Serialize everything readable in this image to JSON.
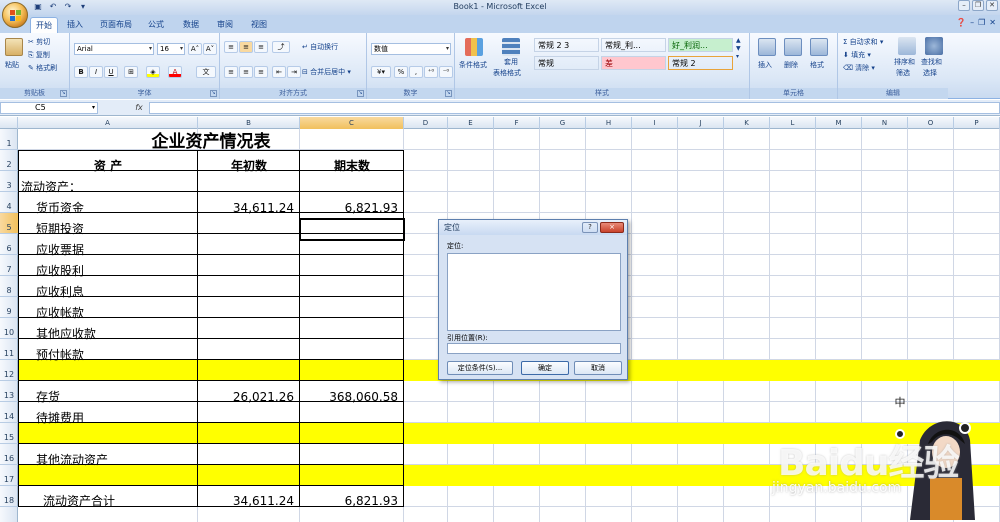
{
  "window": {
    "title": "Book1 - Microsoft Excel"
  },
  "tabs": [
    {
      "label": "开始",
      "active": true
    },
    {
      "label": "插入"
    },
    {
      "label": "页面布局"
    },
    {
      "label": "公式"
    },
    {
      "label": "数据"
    },
    {
      "label": "审阅"
    },
    {
      "label": "视图"
    }
  ],
  "ribbon": {
    "clipboard": {
      "label": "剪贴板",
      "paste": "粘贴",
      "cut": "剪切",
      "copy": "复制",
      "format_painter": "格式刷"
    },
    "font": {
      "label": "字体",
      "font_name": "Arial",
      "font_size": "16",
      "bold": "B",
      "italic": "I",
      "underline": "U"
    },
    "alignment": {
      "label": "对齐方式",
      "wrap": "自动换行",
      "merge": "合并后居中"
    },
    "number": {
      "label": "数字",
      "format": "数值",
      "percent": "%"
    },
    "styles": {
      "label": "样式",
      "conditional": "条件格式",
      "table": "套用",
      "table2": "表格格式",
      "cells": [
        {
          "text": "常规 2 3",
          "bg": "#ffffff"
        },
        {
          "text": "常规_利...",
          "bg": "#ffffff"
        },
        {
          "text": "好_利润...",
          "bg": "#c6efce",
          "color": "#006100"
        },
        {
          "text": "常规",
          "bg": "#ffffff"
        },
        {
          "text": "差",
          "bg": "#ffc7ce",
          "color": "#9c0006"
        },
        {
          "text": "常规 2",
          "bg": "#ffffff"
        }
      ]
    },
    "cells_group": {
      "label": "单元格",
      "insert": "插入",
      "delete": "删除",
      "format": "格式"
    },
    "editing": {
      "label": "编辑",
      "autosum": "自动求和",
      "fill": "填充",
      "clear": "清除",
      "sort": "排序和",
      "sort2": "筛选",
      "find": "查找和",
      "find2": "选择"
    }
  },
  "formula_bar": {
    "name_box": "C5",
    "fx": "fx"
  },
  "columns": [
    "A",
    "B",
    "C",
    "D",
    "E",
    "F",
    "G",
    "H",
    "I",
    "J",
    "K",
    "L",
    "M",
    "N",
    "O",
    "P"
  ],
  "rows": [
    "1",
    "2",
    "3",
    "4",
    "5",
    "6",
    "7",
    "8",
    "9",
    "10",
    "11",
    "12",
    "13",
    "14",
    "15",
    "16",
    "17",
    "18"
  ],
  "sheet": {
    "title": "企业资产情况表",
    "header": {
      "a": "资        产",
      "b": "年初数",
      "c": "期末数"
    },
    "section": "流动资产：",
    "r4": {
      "a": "货币资金",
      "b": "34,611.24",
      "c": "6,821.93"
    },
    "r5": {
      "a": "短期投资"
    },
    "r6": {
      "a": "应收票据"
    },
    "r7": {
      "a": "应收股利"
    },
    "r8": {
      "a": "应收利息"
    },
    "r9": {
      "a": "应收帐款"
    },
    "r10": {
      "a": "其他应收款"
    },
    "r11": {
      "a": "预付帐款"
    },
    "r13": {
      "a": "存货",
      "b": "26,021.26",
      "c": "368,060.58"
    },
    "r14": {
      "a": "待摊费用"
    },
    "r16": {
      "a": "其他流动资产"
    },
    "r18": {
      "a": "流动资产合计",
      "b": "34,611.24",
      "c": "6,821.93"
    },
    "highlight_color": "#ffff00"
  },
  "dialog": {
    "title": "定位",
    "goto_label": "定位:",
    "ref_label": "引用位置(R):",
    "special_button": "定位条件(S)...",
    "ok_button": "确定",
    "cancel_button": "取消",
    "help": "?",
    "close": "×"
  },
  "watermark": {
    "text": "Baidu经验",
    "url": "jingyan.baidu.com",
    "ime": "中"
  }
}
